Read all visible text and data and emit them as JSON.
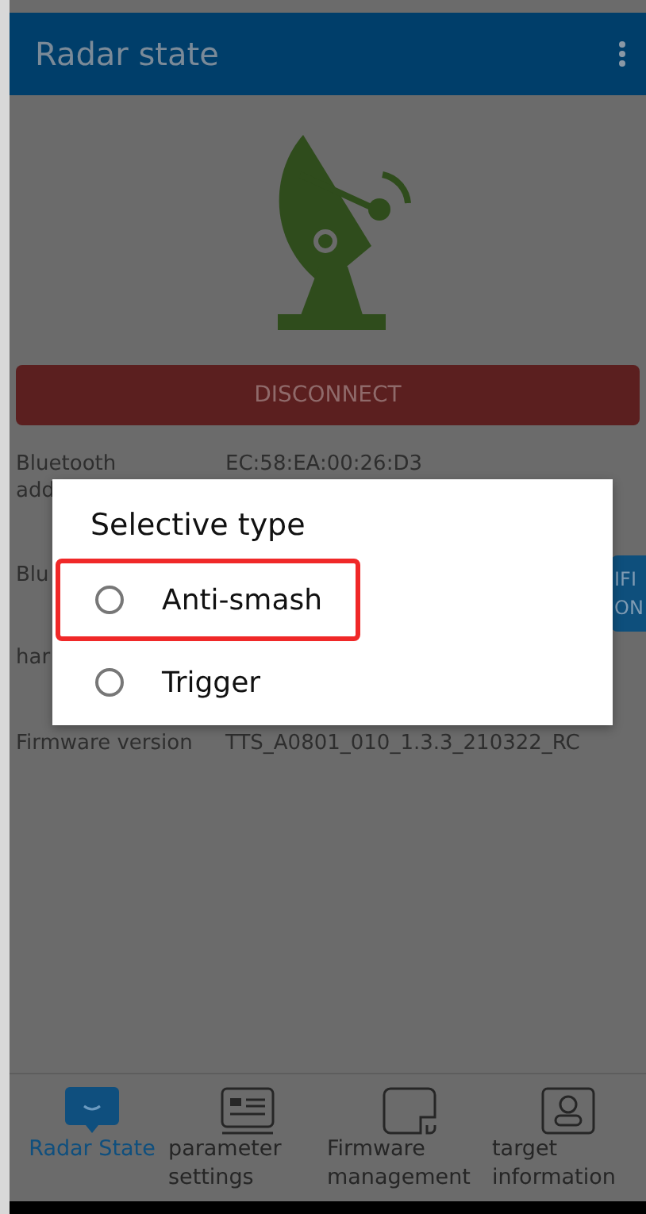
{
  "app_bar": {
    "title": "Radar state"
  },
  "disconnect_button": "DISCONNECT",
  "info_rows": [
    {
      "label": "Bluetooth",
      "label_line_2": "add",
      "value": "EC:58:EA:00:26:D3"
    },
    {
      "label": "Blu",
      "button": [
        "IFI",
        "ON"
      ]
    },
    {
      "label": "har"
    },
    {
      "label": "Firmware version",
      "value": "TTS_A0801_010_1.3.3_210322_RC"
    }
  ],
  "dialog": {
    "title": "Selective type",
    "options": [
      {
        "label": "Anti-smash",
        "selected": false,
        "highlighted": true
      },
      {
        "label": "Trigger",
        "selected": false,
        "highlighted": false
      }
    ]
  },
  "bottom_nav": [
    {
      "label": "Radar State",
      "kind": "radar",
      "selected": true
    },
    {
      "label": "parameter settings",
      "kind": "params",
      "selected": false
    },
    {
      "label": "Firmware management",
      "kind": "firmware",
      "selected": false
    },
    {
      "label": "target information",
      "kind": "target",
      "selected": false
    }
  ]
}
